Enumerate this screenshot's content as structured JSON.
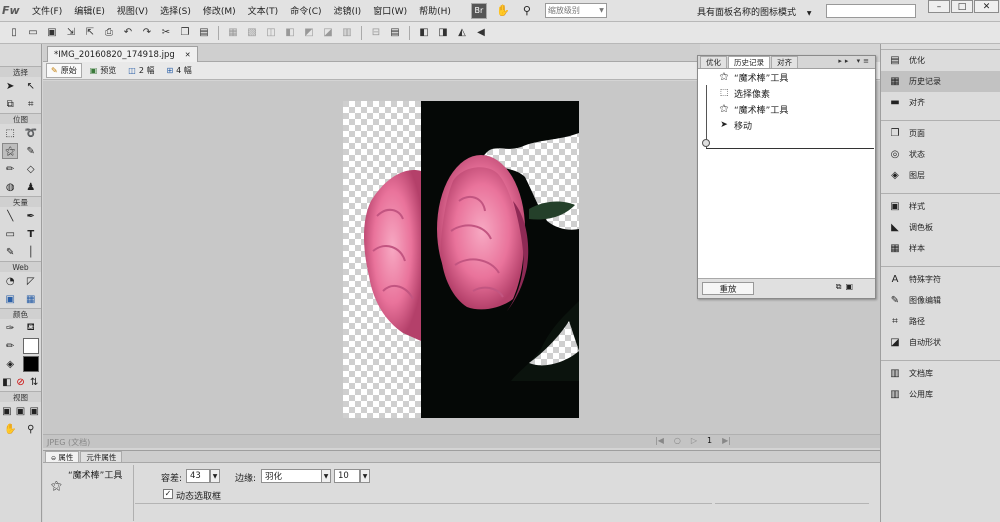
{
  "app": {
    "logo": "Fw",
    "menu": [
      "文件(F)",
      "编辑(E)",
      "视图(V)",
      "选择(S)",
      "修改(M)",
      "文本(T)",
      "命令(C)",
      "滤镜(I)",
      "窗口(W)",
      "帮助(H)"
    ],
    "bridge_button": "Br",
    "zoom_placeholder": "缩放级别",
    "workspace_label": "具有面板名称的图标模式",
    "window_controls": [
      "–",
      "□",
      "✕"
    ]
  },
  "document": {
    "tab_title": "*IMG_20160820_174918.jpg",
    "tab_close": "✕",
    "view_modes": [
      "原始",
      "预览",
      "2 幅",
      "4 幅"
    ],
    "status_label": "JPEG (文档)",
    "page_number": "1"
  },
  "tools": {
    "sections": [
      "选择",
      "位图",
      "矢量",
      "Web",
      "颜色",
      "视图"
    ]
  },
  "history_panel": {
    "tabs": [
      "优化",
      "历史记录",
      "对齐"
    ],
    "items": [
      {
        "label": "“魔术棒”工具",
        "icon": "magic-wand-icon"
      },
      {
        "label": "选择像素",
        "icon": "marquee-icon"
      },
      {
        "label": "“魔术棒”工具",
        "icon": "magic-wand-icon"
      },
      {
        "label": "移动",
        "icon": "pointer-icon"
      }
    ],
    "replay_label": "重放"
  },
  "right_dock": {
    "items": [
      {
        "label": "优化",
        "icon": "optimize-icon",
        "glyph": "▤"
      },
      {
        "label": "历史记录",
        "icon": "history-icon",
        "glyph": "▦",
        "active": true
      },
      {
        "label": "对齐",
        "icon": "align-icon",
        "glyph": "▬"
      },
      {
        "label": "页面",
        "icon": "pages-icon",
        "glyph": "❐",
        "group_start": true
      },
      {
        "label": "状态",
        "icon": "states-icon",
        "glyph": "◎"
      },
      {
        "label": "图层",
        "icon": "layers-icon",
        "glyph": "◈"
      },
      {
        "label": "样式",
        "icon": "styles-icon",
        "glyph": "▣",
        "group_start": true
      },
      {
        "label": "调色板",
        "icon": "palette-icon",
        "glyph": "◣"
      },
      {
        "label": "样本",
        "icon": "swatches-icon",
        "glyph": "▦"
      },
      {
        "label": "特殊字符",
        "icon": "special-chars-icon",
        "glyph": "A",
        "group_start": true
      },
      {
        "label": "图像编辑",
        "icon": "image-edit-icon",
        "glyph": "✎"
      },
      {
        "label": "路径",
        "icon": "path-icon",
        "glyph": "⌗"
      },
      {
        "label": "自动形状",
        "icon": "auto-shapes-icon",
        "glyph": "◪"
      },
      {
        "label": "文档库",
        "icon": "doc-library-icon",
        "glyph": "▥",
        "group_start": true
      },
      {
        "label": "公用库",
        "icon": "common-library-icon",
        "glyph": "▥"
      }
    ]
  },
  "properties": {
    "tabs": [
      "属性",
      "元件属性"
    ],
    "tool_name": "“魔术棒”工具",
    "tolerance_label": "容差:",
    "tolerance_value": "43",
    "edge_label": "边缘:",
    "edge_value": "羽化",
    "feather_value": "10",
    "live_marquee_label": "动态选取框",
    "live_marquee_checked": true
  },
  "colors": {
    "accent_selection": "#4a7fc1",
    "flower_pink": "#e9739b",
    "leaf_green": "#24402a"
  }
}
